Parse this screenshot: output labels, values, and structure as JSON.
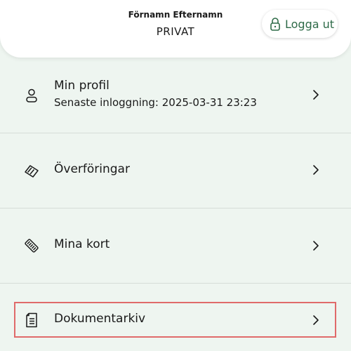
{
  "header": {
    "user_name": "Förnamn Efternamn",
    "account_type": "PRIVAT",
    "logout_label": "Logga ut",
    "logout_icon": "lock-icon",
    "accent_color": "#2e6b48"
  },
  "menu": {
    "items": [
      {
        "title": "Min profil",
        "subtitle": "Senaste inloggning: 2025-03-31 23:23",
        "icon": "user-icon"
      },
      {
        "title": "Överföringar",
        "icon": "transfer-icon"
      },
      {
        "title": "Mina kort",
        "icon": "card-icon"
      },
      {
        "title": "Dokumentarkiv",
        "icon": "document-icon"
      }
    ],
    "chevron_icon": "chevron-right-icon"
  }
}
